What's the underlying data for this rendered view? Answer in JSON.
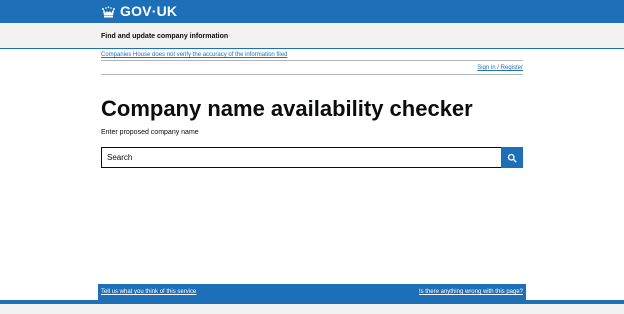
{
  "header": {
    "logo_text": "GOV·UK",
    "logo_icon": "crown-icon",
    "brand_color": "#1d70b8"
  },
  "service": {
    "name": "Find and update company information"
  },
  "notice": {
    "disclaimer": "Companies House does not verify the accuracy of the information filed",
    "sign_in": "Sign in / Register"
  },
  "main": {
    "title": "Company name availability checker",
    "label": "Enter proposed company name",
    "search": {
      "placeholder": "Search",
      "value": "",
      "button_icon": "search-icon"
    }
  },
  "feedback": {
    "left_link": "Tell us what you think of this service",
    "right_link": "Is there anything wrong with this page?"
  },
  "colors": {
    "text": "#0b0c0c",
    "link": "#1d70b8",
    "panel": "#f3f2f1"
  }
}
